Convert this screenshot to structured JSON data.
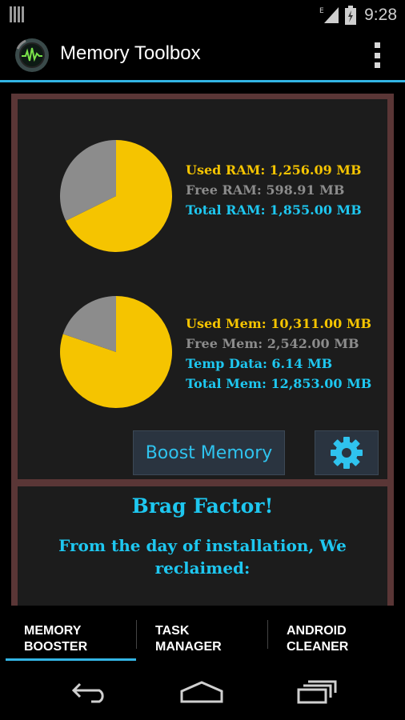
{
  "status_bar": {
    "time": "9:28",
    "network_badge": "E",
    "icons": [
      "notification-bars-icon",
      "signal-icon",
      "battery-icon"
    ]
  },
  "action_bar": {
    "title": "Memory Toolbox",
    "icon": "app-logo-icon",
    "overflow_icon": "overflow-menu-icon"
  },
  "ram": {
    "used_label": "Used RAM: 1,256.09 MB",
    "free_label": "Free RAM: 598.91 MB",
    "total_label": "Total RAM: 1,855.00 MB"
  },
  "storage": {
    "used_label": "Used Mem: 10,311.00 MB",
    "free_label": "Free Mem: 2,542.00 MB",
    "temp_label": "Temp Data: 6.14 MB",
    "total_label": "Total Mem: 12,853.00 MB"
  },
  "actions": {
    "boost_label": "Boost Memory",
    "settings_icon": "gear-icon"
  },
  "brag": {
    "title": "Brag Factor!",
    "text": "From the day of installation, We reclaimed:"
  },
  "tabs": [
    {
      "label": "MEMORY\nBOOSTER",
      "selected": true
    },
    {
      "label": "TASK\nMANAGER",
      "selected": false
    },
    {
      "label": "ANDROID\nCLEANER",
      "selected": false
    }
  ],
  "nav": {
    "back_icon": "back-icon",
    "home_icon": "home-icon",
    "recents_icon": "recent-apps-icon"
  },
  "colors": {
    "accent": "#33b5e5",
    "used": "#f5c400",
    "free": "#8c8c8c",
    "total": "#1ec7f0",
    "card_border": "#5a3636"
  },
  "chart_data": [
    {
      "type": "pie",
      "categories": [
        "Used RAM",
        "Free RAM"
      ],
      "values": [
        1256.09,
        598.91
      ],
      "colors": [
        "#f5c400",
        "#8c8c8c"
      ]
    },
    {
      "type": "pie",
      "categories": [
        "Used Mem",
        "Free Mem"
      ],
      "values": [
        10311.0,
        2542.0
      ],
      "colors": [
        "#f5c400",
        "#8c8c8c"
      ]
    }
  ]
}
